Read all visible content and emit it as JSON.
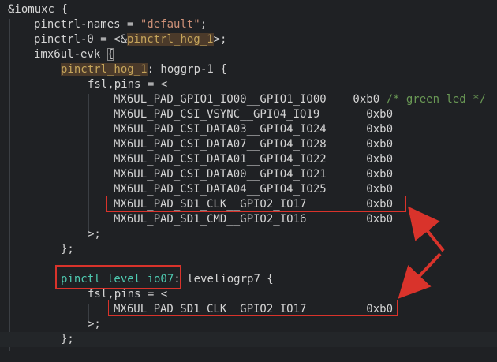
{
  "editor": {
    "lines": [
      {
        "indent": 0,
        "tokens": [
          {
            "t": "&iomuxc {",
            "c": "tok-ident"
          }
        ]
      },
      {
        "indent": 1,
        "tokens": [
          {
            "t": "pinctrl-names = ",
            "c": "tok-prop"
          },
          {
            "t": "\"default\"",
            "c": "tok-string"
          },
          {
            "t": ";",
            "c": "tok-punct"
          }
        ]
      },
      {
        "indent": 1,
        "tokens": [
          {
            "t": "pinctrl-0 = <&",
            "c": "tok-prop"
          },
          {
            "t": "pinctrl_hog_1",
            "c": "hl-ref"
          },
          {
            "t": ">;",
            "c": "tok-punct"
          }
        ]
      },
      {
        "indent": 1,
        "tokens": [
          {
            "t": "imx6ul-evk ",
            "c": "tok-ident"
          },
          {
            "t": "{",
            "c": "bracket-box"
          }
        ]
      },
      {
        "indent": 2,
        "tokens": [
          {
            "t": "pinctrl_hog_1",
            "c": "hl-label"
          },
          {
            "t": ": hoggrp-1 {",
            "c": "tok-ident"
          }
        ]
      },
      {
        "indent": 3,
        "tokens": [
          {
            "t": "fsl,pins = <",
            "c": "tok-prop"
          }
        ]
      },
      {
        "indent": 4,
        "tokens": [
          {
            "t": "MX6UL_PAD_GPIO1_IO00__GPIO1_IO00    0xb0 ",
            "c": "tok-num"
          },
          {
            "t": "/* green led */",
            "c": "tok-comment"
          }
        ]
      },
      {
        "indent": 4,
        "tokens": [
          {
            "t": "MX6UL_PAD_CSI_VSYNC__GPIO4_IO19       0xb0",
            "c": "tok-num"
          }
        ]
      },
      {
        "indent": 4,
        "tokens": [
          {
            "t": "MX6UL_PAD_CSI_DATA03__GPIO4_IO24      0xb0",
            "c": "tok-num"
          }
        ]
      },
      {
        "indent": 4,
        "tokens": [
          {
            "t": "MX6UL_PAD_CSI_DATA07__GPIO4_IO28      0xb0",
            "c": "tok-num"
          }
        ]
      },
      {
        "indent": 4,
        "tokens": [
          {
            "t": "MX6UL_PAD_CSI_DATA01__GPIO4_IO22      0xb0",
            "c": "tok-num"
          }
        ]
      },
      {
        "indent": 4,
        "tokens": [
          {
            "t": "MX6UL_PAD_CSI_DATA00__GPIO4_IO21      0xb0",
            "c": "tok-num"
          }
        ]
      },
      {
        "indent": 4,
        "tokens": [
          {
            "t": "MX6UL_PAD_CSI_DATA04__GPIO4_IO25      0xb0",
            "c": "tok-num"
          }
        ]
      },
      {
        "indent": 4,
        "tokens": [
          {
            "t": "MX6UL_PAD_SD1_CLK__GPIO2_IO17         0xb0",
            "c": "tok-num"
          }
        ]
      },
      {
        "indent": 4,
        "tokens": [
          {
            "t": "MX6UL_PAD_SD1_CMD__GPIO2_IO16         0xb0",
            "c": "tok-num"
          }
        ]
      },
      {
        "indent": 3,
        "tokens": [
          {
            "t": ">;",
            "c": "tok-punct"
          }
        ]
      },
      {
        "indent": 2,
        "tokens": [
          {
            "t": "};",
            "c": "tok-punct"
          }
        ]
      },
      {
        "indent": 0,
        "tokens": []
      },
      {
        "indent": 2,
        "tokens": [
          {
            "t": "pinctl_level_io07",
            "c": "tok-green"
          },
          {
            "t": ": leveliogrp7 {",
            "c": "tok-ident"
          }
        ]
      },
      {
        "indent": 3,
        "tokens": [
          {
            "t": "fsl,pins = <",
            "c": "tok-prop"
          }
        ]
      },
      {
        "indent": 4,
        "tokens": [
          {
            "t": "MX6UL_PAD_SD1_CLK__GPIO2_IO17         0xb0",
            "c": "tok-num"
          }
        ]
      },
      {
        "indent": 3,
        "tokens": [
          {
            "t": ">;",
            "c": "tok-punct"
          }
        ]
      },
      {
        "indent": 2,
        "tokens": [
          {
            "t": "};",
            "c": "tok-punct"
          }
        ]
      }
    ],
    "current_line": 22,
    "colors": {
      "background": "#1f2124",
      "annotation": "#d9332b"
    }
  }
}
